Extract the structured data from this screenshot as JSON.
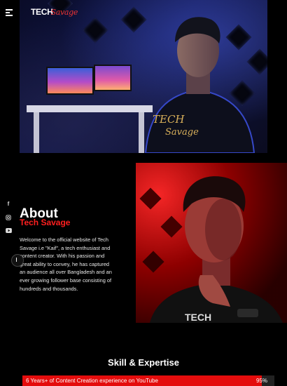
{
  "brand": {
    "logo_main": "TECH",
    "logo_script": "Savage"
  },
  "icons": {
    "menu": "hamburger-icon",
    "social": [
      "facebook-icon",
      "instagram-icon",
      "youtube-icon"
    ],
    "scroll": "scroll-indicator-icon"
  },
  "about": {
    "title": "About",
    "subtitle": "Tech Savage",
    "text": "Welcome to the official website of Tech Savage i.e \"Kaif\", a tech enthusiast and content creator. With his passion and great ability to convey, he has captured an audience all over Bangladesh and an ever growing follower base consisting of hundreds and thousands."
  },
  "skills": {
    "title": "Skill & Expertise",
    "items": [
      {
        "label": "6 Years+ of Content Creation experience on YouTube",
        "percent_text": "95%",
        "percent": 95
      }
    ]
  },
  "colors": {
    "accent": "#e40c0c",
    "background": "#000000"
  }
}
